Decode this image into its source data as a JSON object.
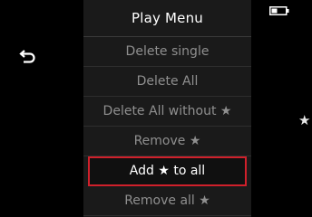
{
  "menu": {
    "title": "Play Menu",
    "items": [
      {
        "label": "Delete single",
        "selected": false
      },
      {
        "label": "Delete All",
        "selected": false
      },
      {
        "label": "Delete All without ★",
        "selected": false
      },
      {
        "label": "Remove ★",
        "selected": false
      },
      {
        "label": "Add ★ to all",
        "selected": true
      },
      {
        "label": "Remove all ★",
        "selected": false
      }
    ]
  },
  "icons": {
    "back": "back-arrow-icon",
    "battery": "battery-icon",
    "side_star": "★"
  },
  "colors": {
    "panel_background": "#1a1a1a",
    "title_text": "#ffffff",
    "item_text": "#8f8f8f",
    "selection_border": "#d0202b"
  }
}
